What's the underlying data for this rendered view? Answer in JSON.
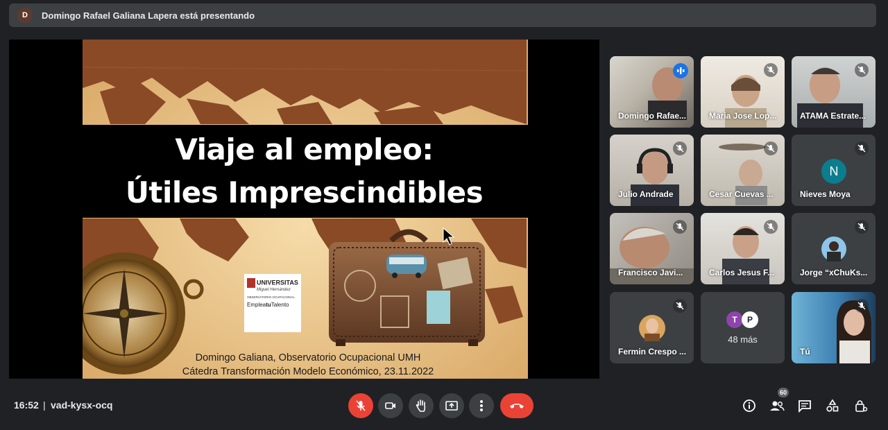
{
  "banner": {
    "avatar_letter": "D",
    "text": "Domingo Rafael Galiana Lapera está presentando"
  },
  "slide": {
    "title_line1": "Viaje al empleo:",
    "title_line2": "Útiles Imprescindibles",
    "logo_line1": "UNIVERSITAS",
    "logo_line2": "Miguel Hernández",
    "logo_line3": "OBSERVATORIO OCUPACIONAL",
    "logo_line4_pre": "Emplea",
    "logo_line4_bold": "tu",
    "logo_line4_post": "Talento",
    "credit_line1": "Domingo Galiana, Observatorio Ocupacional UMH",
    "credit_line2": "Cátedra Transformación Modelo Económico, 23.11.2022"
  },
  "participants": [
    {
      "name": "Domingo Rafae...",
      "speaking": true
    },
    {
      "name": "Maria Jose Lop...",
      "muted": true
    },
    {
      "name": "ATAMA Estrate...",
      "muted": true
    },
    {
      "name": "Julio Andrade",
      "muted": true
    },
    {
      "name": "Cesar Cuevas ...",
      "muted": true
    },
    {
      "name": "Nieves Moya",
      "muted": true,
      "avatar_letter": "N"
    },
    {
      "name": "Francisco Javi...",
      "muted": true
    },
    {
      "name": "Carlos Jesus F...",
      "muted": true
    },
    {
      "name": "Jorge “xChuKs...",
      "muted": true
    },
    {
      "name": "Fermin Crespo ...",
      "muted": true
    },
    {
      "name": "Tú",
      "muted": true
    }
  ],
  "more_tile": {
    "avatar1": "T",
    "avatar2": "P",
    "label": "48 más"
  },
  "bottom_bar": {
    "time": "16:52",
    "separator": "|",
    "meeting_code": "vad-kysx-ocq",
    "people_count": "60",
    "controls": [
      "mic-off-icon",
      "camera-icon",
      "raise-hand-icon",
      "present-icon",
      "more-options-icon",
      "end-call-icon"
    ],
    "right_icons": [
      "info-icon",
      "people-icon",
      "chat-icon",
      "activities-icon",
      "host-controls-icon"
    ]
  },
  "colors": {
    "accent_blue": "#1a73e8",
    "danger_red": "#ea4335",
    "surface": "#3c4043",
    "background": "#202124"
  }
}
